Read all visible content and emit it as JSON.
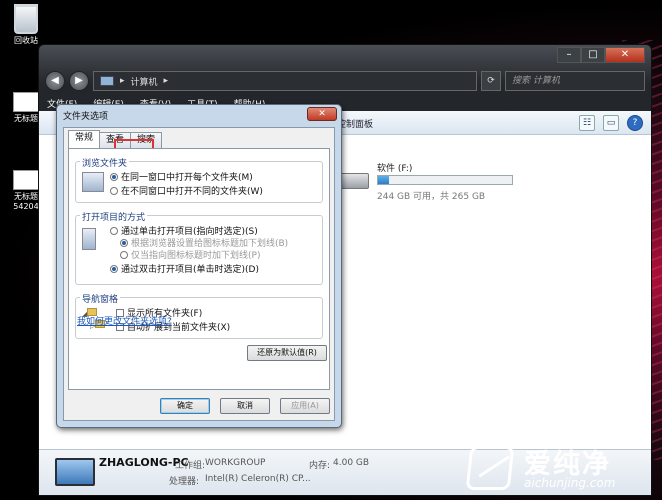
{
  "desktop": {
    "icons": [
      {
        "label": "回收站"
      },
      {
        "label": "无标题"
      },
      {
        "label": "无标题"
      },
      {
        "label": "54204"
      }
    ]
  },
  "explorer": {
    "address": "计算机",
    "search_placeholder": "搜索 计算机",
    "menus": [
      "文件(F)",
      "编辑(E)",
      "查看(V)",
      "工具(T)",
      "帮助(H)"
    ],
    "toolbar_item": "控制面板",
    "drive": {
      "name": "软件 (F:)",
      "free_text": "244 GB 可用，共 265 GB",
      "used_fraction": 0.08
    },
    "details": {
      "pc_name": "ZHAGLONG-PC",
      "workgroup_label": "工作组:",
      "workgroup": "WORKGROUP",
      "memory_label": "内存:",
      "memory": "4.00 GB",
      "processor_label": "处理器:",
      "processor": "Intel(R) Celeron(R) CP..."
    }
  },
  "dialog": {
    "title": "文件夹选项",
    "tabs": [
      "常规",
      "查看",
      "搜索"
    ],
    "browse_group": {
      "title": "浏览文件夹",
      "options": [
        "在同一窗口中打开每个文件夹(M)",
        "在不同窗口中打开不同的文件夹(W)"
      ]
    },
    "click_group": {
      "title": "打开项目的方式",
      "options": [
        "通过单击打开项目(指向时选定)(S)",
        "根据浏览器设置给图标标题加下划线(B)",
        "仅当指向图标标题时加下划线(P)",
        "通过双击打开项目(单击时选定)(D)"
      ]
    },
    "nav_group": {
      "title": "导航窗格",
      "options": [
        "显示所有文件夹(F)",
        "自动扩展到当前文件夹(X)"
      ]
    },
    "restore_button": "还原为默认值(R)",
    "help_link": "我如何更改文件夹选项?",
    "ok_button": "确定",
    "cancel_button": "取消",
    "apply_button": "应用(A)"
  },
  "watermark": {
    "brand_cn": "爱纯净",
    "url": "aichunjing.com"
  }
}
